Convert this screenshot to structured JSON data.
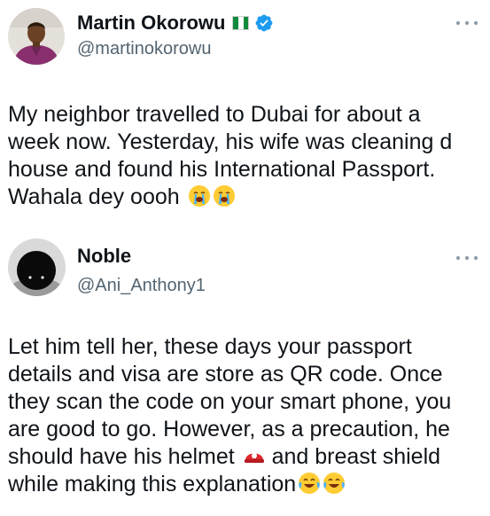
{
  "tweets": [
    {
      "author": {
        "display_name": "Martin Okorowu",
        "handle": "@martinokorowu",
        "flag_icon": "nigeria-flag-icon",
        "verified_icon": "verified-badge-icon",
        "verified_color": "#1d9bf0"
      },
      "more_icon": "more-options-icon",
      "text_lines": [
        "My neighbor travelled to Dubai for about a",
        "week now. Yesterday, his wife was cleaning d",
        "house and found his International Passport.",
        "Wahala dey oooh"
      ],
      "emojis": [
        "loudly-crying-face-emoji",
        "loudly-crying-face-emoji"
      ]
    },
    {
      "author": {
        "display_name": "Noble",
        "handle": "@Ani_Anthony1"
      },
      "more_icon": "more-options-icon",
      "text_lines": [
        "Let him tell her, these days your passport",
        "details and visa are store as QR code. Once",
        "they scan the code on your smart phone, you",
        "are good to go. However, as a precaution, he",
        "should have his helmet",
        "and breast shield",
        "while making this explanation"
      ],
      "emojis": [
        "rescue-helmet-emoji",
        "face-with-tears-of-joy-emoji",
        "face-with-tears-of-joy-emoji"
      ]
    }
  ],
  "colors": {
    "text": "#0f1419",
    "secondary": "#536471",
    "accent": "#1d9bf0"
  }
}
